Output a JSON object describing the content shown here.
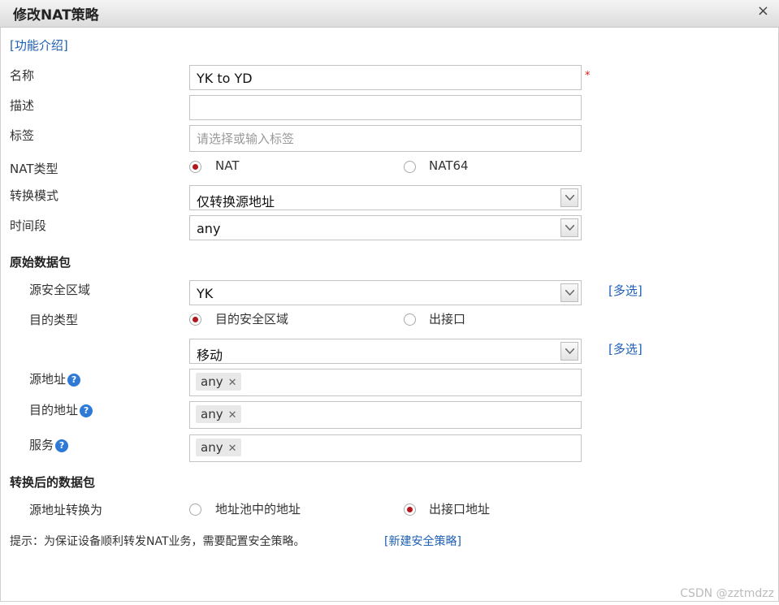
{
  "dialog": {
    "title": "修改NAT策略",
    "close_glyph": "×"
  },
  "intro_link": "[功能介绍]",
  "fields": {
    "name_label": "名称",
    "name_value": "YK to YD",
    "required_mark": "*",
    "desc_label": "描述",
    "desc_value": "",
    "tag_label": "标签",
    "tag_placeholder": "请选择或输入标签",
    "nat_type_label": "NAT类型",
    "nat_type_options": [
      "NAT",
      "NAT64"
    ],
    "nat_type_selected": "NAT",
    "mode_label": "转换模式",
    "mode_value": "仅转换源地址",
    "time_label": "时间段",
    "time_value": "any"
  },
  "original_packet": {
    "heading": "原始数据包",
    "src_zone_label": "源安全区域",
    "src_zone_value": "YK",
    "src_zone_multi": "[多选]",
    "dest_type_label": "目的类型",
    "dest_type_options": [
      "目的安全区域",
      "出接口"
    ],
    "dest_type_selected": "目的安全区域",
    "dest_zone_value": "移动",
    "dest_zone_multi": "[多选]",
    "src_addr_label": "源地址",
    "src_addr_tag": "any",
    "dst_addr_label": "目的地址",
    "dst_addr_tag": "any",
    "service_label": "服务",
    "service_tag": "any",
    "tag_remove_glyph": "✕",
    "help_glyph": "?"
  },
  "translated_packet": {
    "heading": "转换后的数据包",
    "src_translate_label": "源地址转换为",
    "options": [
      "地址池中的地址",
      "出接口地址"
    ],
    "selected": "出接口地址"
  },
  "hint": {
    "text": "提示：为保证设备顺利转发NAT业务，需要配置安全策略。",
    "link": "[新建安全策略]"
  },
  "watermark": "CSDN @zztmdzz",
  "colors": {
    "link": "#1d5fb4",
    "radio_selected": "#b1171c",
    "required": "#d21111",
    "help_icon": "#2f7ad6"
  }
}
